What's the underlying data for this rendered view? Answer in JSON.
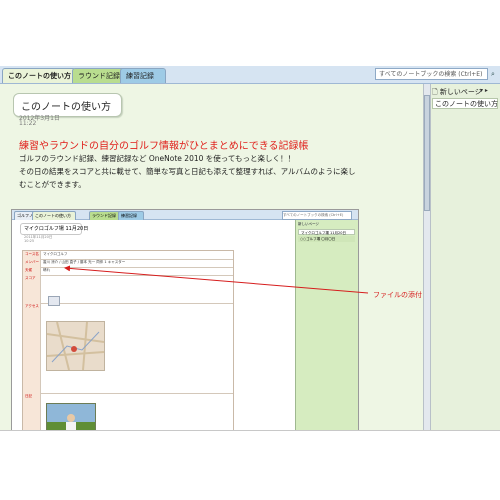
{
  "tabs": [
    {
      "label": "このノートの使い方"
    },
    {
      "label": "ラウンド記録"
    },
    {
      "label": "練習記録"
    }
  ],
  "search": {
    "placeholder": "すべてのノートブックの検索 (Ctrl+E)"
  },
  "page": {
    "title": "このノートの使い方",
    "date": "2012年3月1日",
    "time": "11:22",
    "headline": "練習やラウンドの自分のゴルフ情報がひとまとめにできる記録帳",
    "body": [
      "ゴルフのラウンド記録、練習記録など OneNote 2010 を使ってもっと楽しく！！",
      "その日の結果をスコアと共に載せて、簡単な写真と日記も添えて整理すれば、アルバムのように楽し",
      "むことができます。"
    ]
  },
  "annotation": {
    "label": "ファイルの添付",
    "color": "#d61d1d"
  },
  "right_panel": {
    "new_page": "新しいページ",
    "pages": [
      "このノートの使い方"
    ]
  },
  "embedded": {
    "tabs": [
      "ゴルフノート",
      "このノートの使い方",
      "ラウンド記録",
      "練習記録"
    ],
    "search": "すべてのノートブックの検索 (Ctrl+E)",
    "title": "マイクロゴルフ場  11月20日",
    "date": "2011年11月20日",
    "time": "10:25",
    "rows": [
      {
        "key": "コース名",
        "value": "マイクロゴルフ"
      },
      {
        "key": "メンバー",
        "value": "香川 涼介  /  山田 直子  /  藤本 光一  同伴 1 キャスター"
      },
      {
        "key": "天候",
        "value": "晴れ"
      },
      {
        "key": "スコア",
        "value": ""
      },
      {
        "key": "アクセス",
        "value": "アクセスマップ"
      },
      {
        "key": "日記",
        "value": ""
      }
    ],
    "right_new_page": "新しいページ",
    "right_pages": [
      "マイクロゴルフ場  11月20日",
      "○○ゴルフ場  〇月〇日"
    ]
  },
  "colors": {
    "accent": "#e0201b",
    "page_bg": "#eef6e4",
    "tab_green": "#b9dd8f",
    "tab_blue": "#9ecbe6"
  }
}
